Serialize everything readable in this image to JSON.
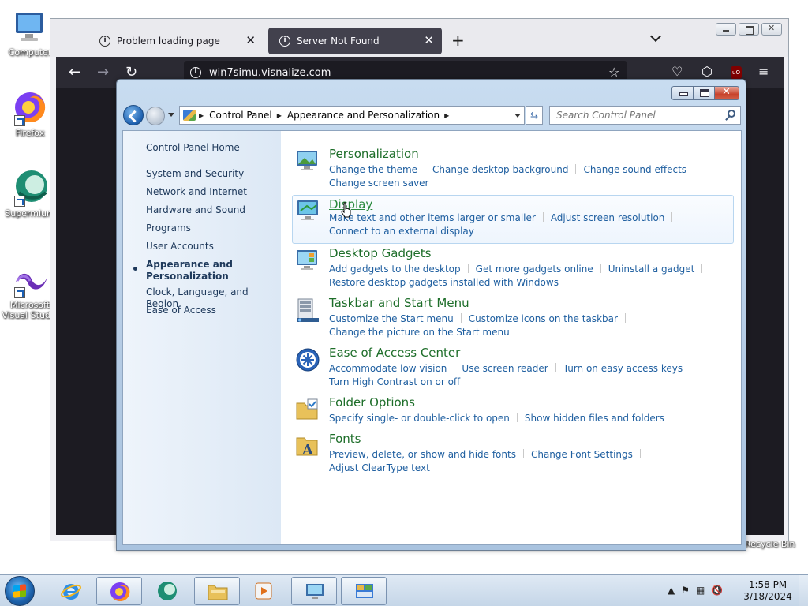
{
  "desktop": {
    "icons": [
      {
        "label": "Computer"
      },
      {
        "label": "Firefox"
      },
      {
        "label": "Supermium"
      },
      {
        "label": "Microsoft Visual Studio"
      }
    ],
    "recycle_bin": "Recycle Bin"
  },
  "firefox": {
    "tabs": [
      {
        "title": "Problem loading page"
      },
      {
        "title": "Server Not Found"
      }
    ],
    "url": "win7simu.visnalize.com",
    "new_tab": "+",
    "back": "←",
    "forward": "→",
    "reload": "↻",
    "bookmark_star": "☆",
    "extensions_icon": "⬡",
    "menu_icon": "≡",
    "ublock_label": "uO"
  },
  "control_panel": {
    "breadcrumb": [
      "Control Panel",
      "Appearance and Personalization"
    ],
    "search_placeholder": "Search Control Panel",
    "nav": {
      "home": "Control Panel Home",
      "items": [
        "System and Security",
        "Network and Internet",
        "Hardware and Sound",
        "Programs",
        "User Accounts",
        "Appearance and Personalization",
        "Clock, Language, and Region",
        "Ease of Access"
      ],
      "current_index": 5
    },
    "categories": [
      {
        "title": "Personalization",
        "links": [
          "Change the theme",
          "Change desktop background",
          "Change sound effects",
          "Change screen saver"
        ]
      },
      {
        "title": "Display",
        "links": [
          "Make text and other items larger or smaller",
          "Adjust screen resolution",
          "Connect to an external display"
        ]
      },
      {
        "title": "Desktop Gadgets",
        "links": [
          "Add gadgets to the desktop",
          "Get more gadgets online",
          "Uninstall a gadget",
          "Restore desktop gadgets installed with Windows"
        ]
      },
      {
        "title": "Taskbar and Start Menu",
        "links": [
          "Customize the Start menu",
          "Customize icons on the taskbar",
          "Change the picture on the Start menu"
        ]
      },
      {
        "title": "Ease of Access Center",
        "links": [
          "Accommodate low vision",
          "Use screen reader",
          "Turn on easy access keys",
          "Turn High Contrast on or off"
        ]
      },
      {
        "title": "Folder Options",
        "links": [
          "Specify single- or double-click to open",
          "Show hidden files and folders"
        ]
      },
      {
        "title": "Fonts",
        "links": [
          "Preview, delete, or show and hide fonts",
          "Change Font Settings",
          "Adjust ClearType text"
        ]
      }
    ]
  },
  "taskbar": {
    "time": "1:58 PM",
    "date": "3/18/2024"
  },
  "colors": {
    "category_title": "#1e6e2a",
    "link": "#1f5fa0",
    "nav_text": "#1e395b",
    "firefox_dark": "#2b2a33"
  }
}
